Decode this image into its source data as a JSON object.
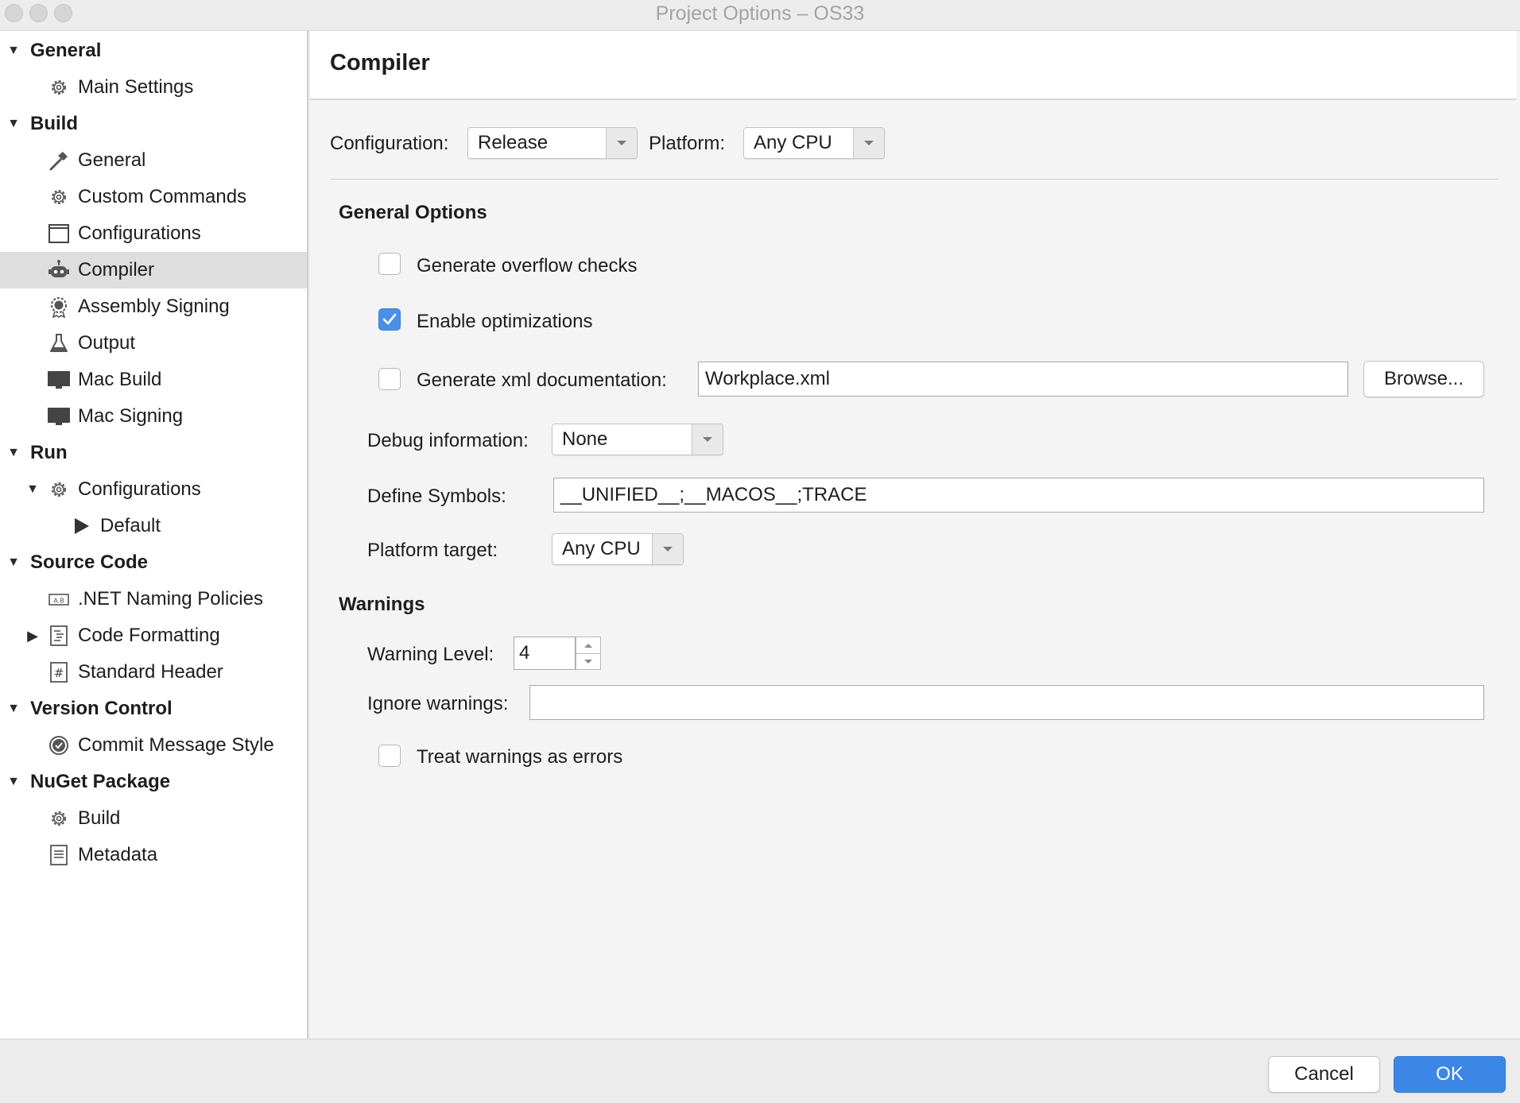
{
  "window": {
    "title": "Project Options – OS33"
  },
  "sidebar": {
    "items": [
      {
        "label": "General",
        "kind": "section",
        "icon": "disclosure-down"
      },
      {
        "label": "Main Settings",
        "kind": "item",
        "icon": "gear-icon"
      },
      {
        "label": "Build",
        "kind": "section",
        "icon": "disclosure-down"
      },
      {
        "label": "General",
        "kind": "item",
        "icon": "hammer-icon"
      },
      {
        "label": "Custom Commands",
        "kind": "item",
        "icon": "gear-icon"
      },
      {
        "label": "Configurations",
        "kind": "item",
        "icon": "window-icon"
      },
      {
        "label": "Compiler",
        "kind": "item",
        "icon": "robot-icon",
        "selected": true
      },
      {
        "label": "Assembly Signing",
        "kind": "item",
        "icon": "badge-icon"
      },
      {
        "label": "Output",
        "kind": "item",
        "icon": "flask-icon"
      },
      {
        "label": "Mac Build",
        "kind": "item",
        "icon": "monitor-icon"
      },
      {
        "label": "Mac Signing",
        "kind": "item",
        "icon": "monitor-icon"
      },
      {
        "label": "Run",
        "kind": "section",
        "icon": "disclosure-down"
      },
      {
        "label": "Configurations",
        "kind": "item",
        "icon": "gear-icon",
        "expanded": true
      },
      {
        "label": "Default",
        "kind": "subitem",
        "icon": "play-icon"
      },
      {
        "label": "Source Code",
        "kind": "section",
        "icon": "disclosure-down"
      },
      {
        "label": ".NET Naming Policies",
        "kind": "item",
        "icon": "naming-icon"
      },
      {
        "label": "Code Formatting",
        "kind": "item",
        "icon": "document-icon",
        "collapsed": true
      },
      {
        "label": "Standard Header",
        "kind": "item",
        "icon": "hash-icon"
      },
      {
        "label": "Version Control",
        "kind": "section",
        "icon": "disclosure-down"
      },
      {
        "label": "Commit Message Style",
        "kind": "item",
        "icon": "check-circle-icon"
      },
      {
        "label": "NuGet Package",
        "kind": "section",
        "icon": "disclosure-down"
      },
      {
        "label": "Build",
        "kind": "item",
        "icon": "gear-icon"
      },
      {
        "label": "Metadata",
        "kind": "item",
        "icon": "list-icon"
      }
    ]
  },
  "main": {
    "title": "Compiler",
    "configuration": {
      "label": "Configuration:",
      "value": "Release"
    },
    "platform": {
      "label": "Platform:",
      "value": "Any CPU"
    },
    "general_options": {
      "heading": "General Options",
      "overflow_checks": {
        "label": "Generate overflow checks",
        "checked": false
      },
      "optimizations": {
        "label": "Enable optimizations",
        "checked": true
      },
      "xml_doc": {
        "label": "Generate xml documentation:",
        "checked": false,
        "value": "Workplace.xml"
      },
      "browse_label": "Browse...",
      "debug_info": {
        "label": "Debug information:",
        "value": "None"
      },
      "define_symbols": {
        "label": "Define Symbols:",
        "value": "__UNIFIED__;__MACOS__;TRACE"
      },
      "platform_target": {
        "label": "Platform target:",
        "value": "Any CPU"
      }
    },
    "warnings": {
      "heading": "Warnings",
      "level": {
        "label": "Warning Level:",
        "value": "4"
      },
      "ignore": {
        "label": "Ignore warnings:",
        "value": ""
      },
      "treat_as_errors": {
        "label": "Treat warnings as errors",
        "checked": false
      }
    }
  },
  "footer": {
    "cancel_label": "Cancel",
    "ok_label": "OK"
  },
  "colors": {
    "accent": "#3c86e6",
    "selection": "#dedede"
  }
}
